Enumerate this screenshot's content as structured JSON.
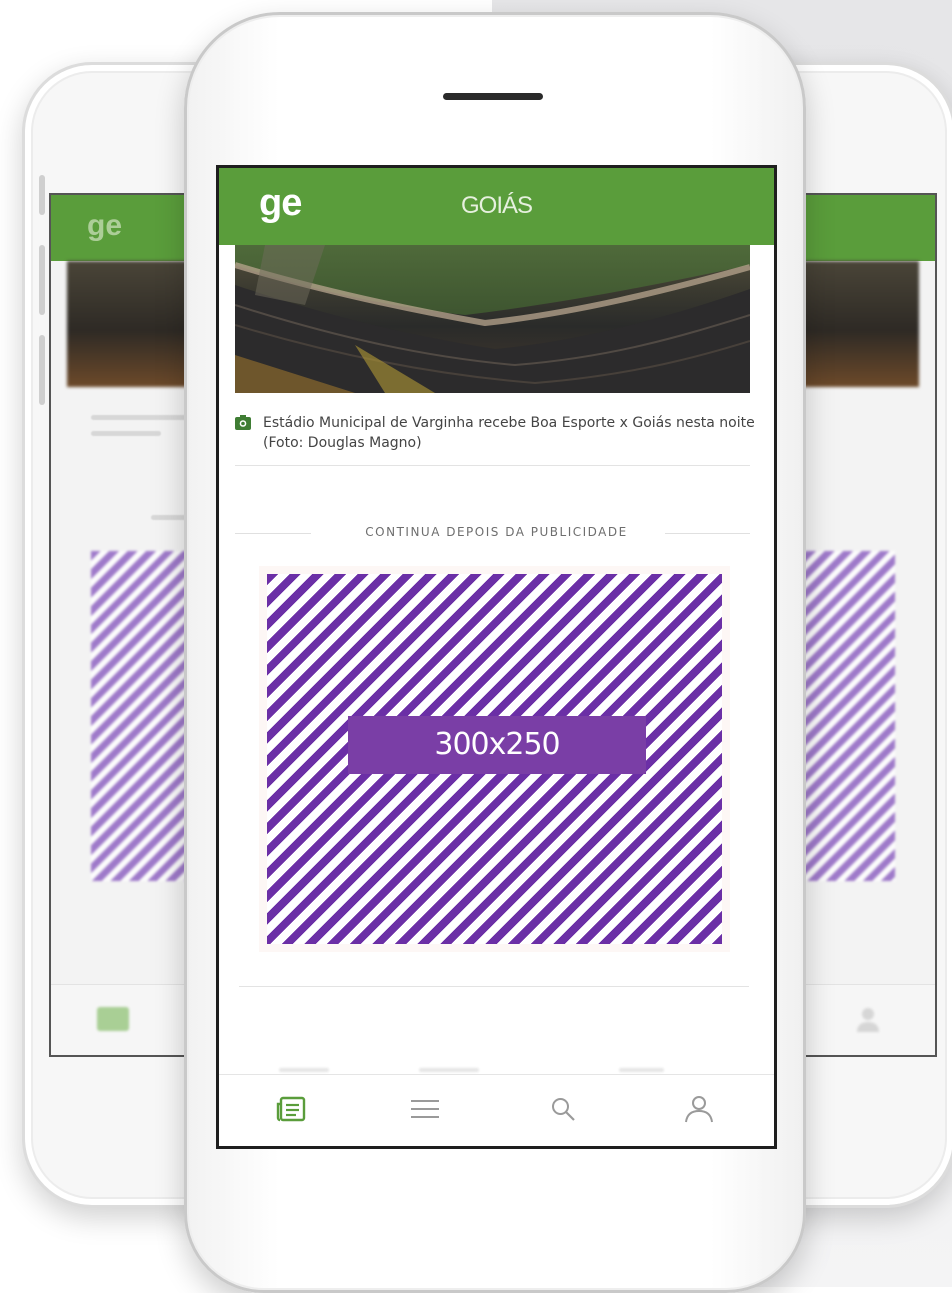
{
  "header": {
    "logo": "ge",
    "section": "GOIÁS"
  },
  "photo_caption": {
    "icon": "camera-icon",
    "text": "Estádio Municipal de Varginha recebe Boa Esporte x Goiás nesta noite (Foto: Douglas Magno)"
  },
  "ad": {
    "label": "CONTINUA DEPOIS DA PUBLICIDADE",
    "size": "300x250"
  },
  "tabbar": {
    "items": [
      {
        "icon": "news-icon",
        "active": true
      },
      {
        "icon": "menu-icon",
        "active": false
      },
      {
        "icon": "search-icon",
        "active": false
      },
      {
        "icon": "user-icon",
        "active": false
      }
    ]
  },
  "colors": {
    "brand_green": "#5a9d3b",
    "ad_purple": "#6b2fa6",
    "ad_label_bg": "#7a3ea6"
  }
}
